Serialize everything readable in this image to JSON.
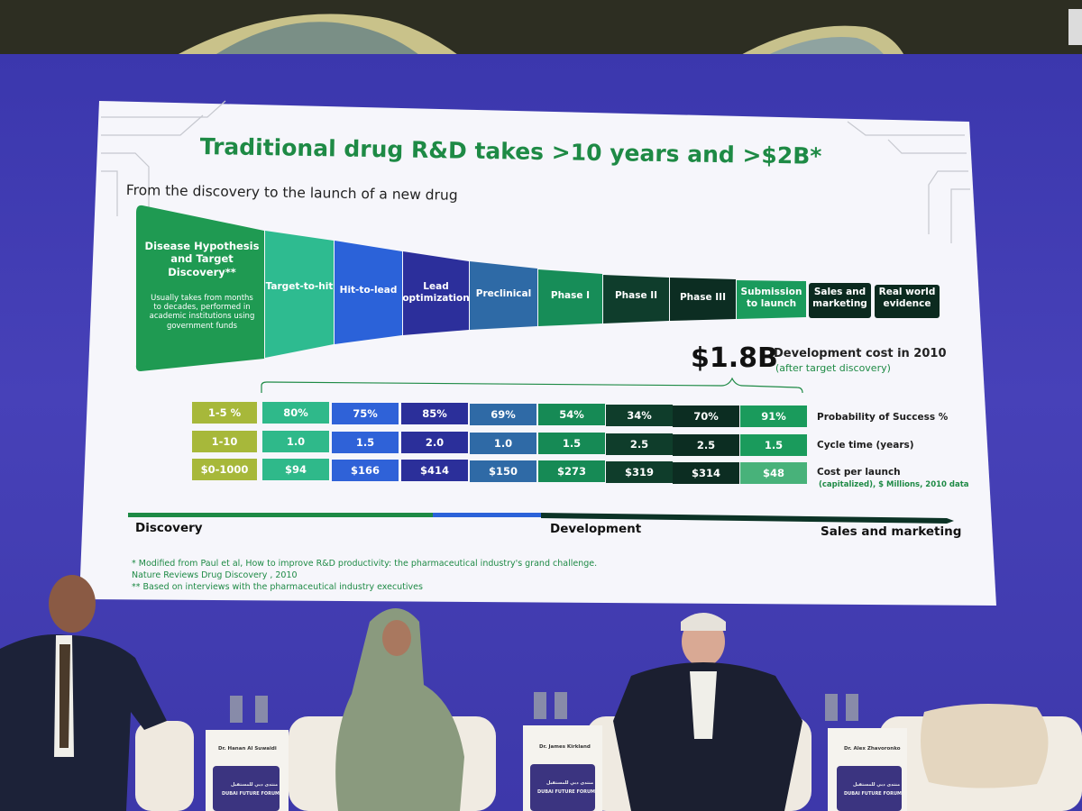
{
  "slide": {
    "title": "Traditional drug R&D takes >10 years and >$2B*",
    "subtitle": "From the discovery to the launch of a new drug",
    "discovery_stage": {
      "title": "Disease Hypothesis and Target Discovery**",
      "note": "Usually takes from months to decades, performed in academic institutions using government funds"
    },
    "funnel_stages": [
      "Target-to-hit",
      "Hit-to-lead",
      "Lead optimization",
      "Preclinical",
      "Phase I",
      "Phase II",
      "Phase III",
      "Submission to launch"
    ],
    "post_stages": [
      "Sales and marketing",
      "Real world evidence"
    ],
    "dev_cost": {
      "amount": "$1.8B",
      "label": "Development cost in 2010",
      "sub": "(after target discovery)"
    },
    "table": {
      "probability": {
        "label": "Probability of Success %",
        "first": "1-5 %",
        "values": [
          "80%",
          "75%",
          "85%",
          "69%",
          "54%",
          "34%",
          "70%",
          "91%"
        ]
      },
      "cycle": {
        "label": "Cycle time (years)",
        "first": "1-10",
        "values": [
          "1.0",
          "1.5",
          "2.0",
          "1.0",
          "1.5",
          "2.5",
          "2.5",
          "1.5"
        ]
      },
      "cost": {
        "label": "Cost per launch",
        "sub": "(capitalized), $ Millions, 2010 data",
        "first": "$0-1000",
        "values": [
          "$94",
          "$166",
          "$414",
          "$150",
          "$273",
          "$319",
          "$314",
          "$48"
        ]
      }
    },
    "phases": [
      "Discovery",
      "Development",
      "Sales and marketing"
    ],
    "footnotes": [
      "* Modified from Paul et al, How to improve R&D productivity: the pharmaceutical industry's grand challenge.",
      "Nature Reviews Drug Discovery , 2010",
      "** Based on interviews with the pharmaceutical industry executives"
    ]
  },
  "nameplates": [
    "Dr. Hanan Al Suwaidi",
    "Dr. James Kirkland",
    "Dr. Alex Zhavoronko"
  ],
  "event": {
    "arabic_name": "منتدى دبي للمستقبل",
    "name": "DUBAI FUTURE FORUM"
  },
  "colors": {
    "title_green": "#1e8a45",
    "teal": "#2fb98a",
    "blue": "#2f62d8",
    "indigo": "#2b2f9a",
    "steel": "#2f6aa6",
    "green": "#168a55",
    "dark_green": "#0f3d2b",
    "olive": "#a7b83a"
  }
}
